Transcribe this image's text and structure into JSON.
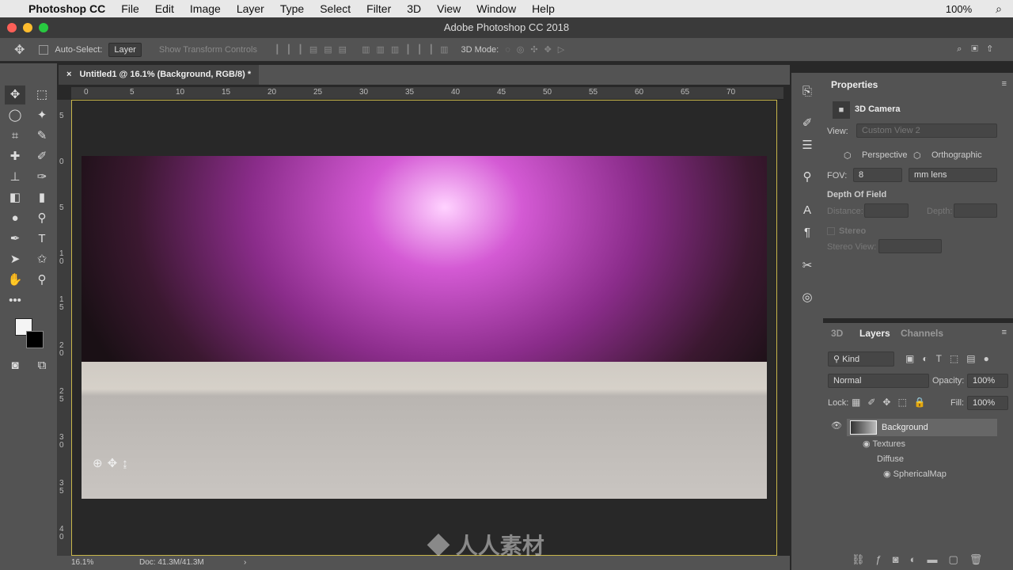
{
  "menubar": {
    "items": [
      "Photoshop CC",
      "File",
      "Edit",
      "Image",
      "Layer",
      "Type",
      "Select",
      "Filter",
      "3D",
      "View",
      "Window",
      "Help"
    ],
    "battery": "100%"
  },
  "window": {
    "title": "Adobe Photoshop CC 2018"
  },
  "options": {
    "auto_select_label": "Auto-Select:",
    "auto_select_value": "Layer",
    "show_transform": "Show Transform Controls",
    "mode_3d": "3D Mode:"
  },
  "document": {
    "tab_title": "Untitled1 @ 16.1% (Background, RGB/8) *"
  },
  "ruler": {
    "h_labels": [
      "0",
      "5",
      "10",
      "15",
      "20",
      "25",
      "30",
      "35",
      "40",
      "45",
      "50",
      "55",
      "60",
      "65",
      "70"
    ],
    "v_labels": [
      "5",
      "0",
      "5",
      "1 0",
      "1 5",
      "2 0",
      "2 5",
      "3 0",
      "3 5",
      "4 0"
    ]
  },
  "status": {
    "zoom": "16.1%",
    "doc": "Doc: 41.3M/41.3M"
  },
  "properties": {
    "title": "Properties",
    "section": "3D Camera",
    "view_label": "View:",
    "view_value": "Custom View 2",
    "perspective": "Perspective",
    "orthographic": "Orthographic",
    "fov_label": "FOV:",
    "fov_value": "8",
    "fov_unit": "mm lens",
    "dof": "Depth Of Field",
    "distance": "Distance:",
    "depth": "Depth:",
    "stereo": "Stereo",
    "stereo_view": "Stereo View:"
  },
  "layers": {
    "tabs": [
      "3D",
      "Layers",
      "Channels"
    ],
    "active_tab": "Layers",
    "kind": "Kind",
    "blend": "Normal",
    "opacity_label": "Opacity:",
    "opacity": "100%",
    "lock_label": "Lock:",
    "fill_label": "Fill:",
    "fill": "100%",
    "items": [
      {
        "name": "Background"
      },
      {
        "name": "Textures"
      },
      {
        "name": "Diffuse"
      },
      {
        "name": "SphericalMap"
      }
    ]
  },
  "watermark": "人人素材"
}
